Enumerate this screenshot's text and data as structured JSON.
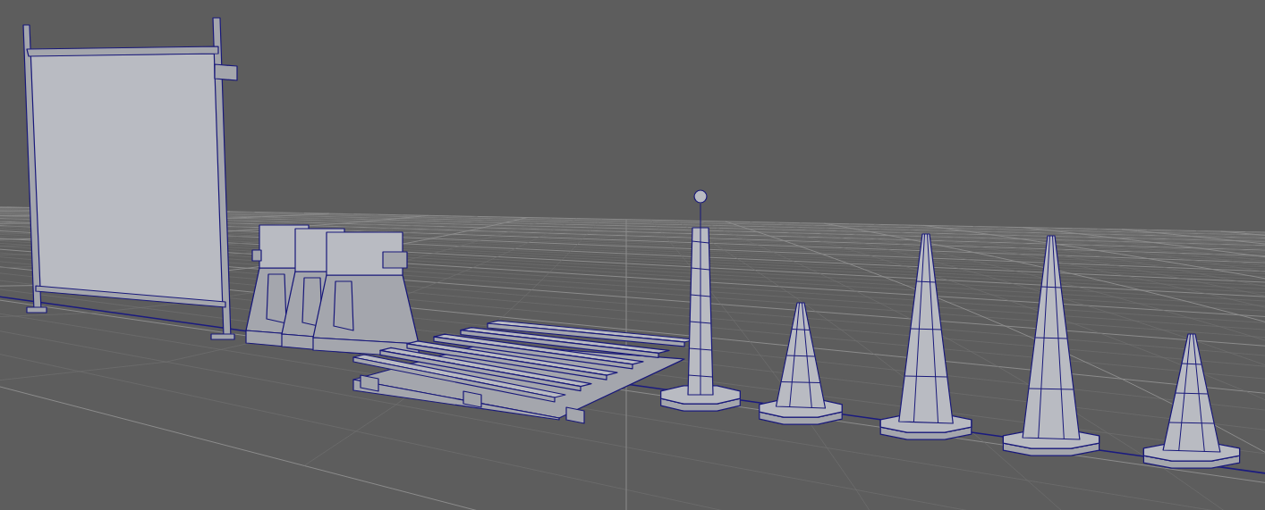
{
  "viewport": {
    "objects": [
      {
        "kind": "fence"
      },
      {
        "kind": "barrier"
      },
      {
        "kind": "pallet"
      },
      {
        "kind": "bollard"
      },
      {
        "kind": "cone"
      },
      {
        "kind": "cone"
      },
      {
        "kind": "cone"
      },
      {
        "kind": "cone"
      }
    ]
  }
}
